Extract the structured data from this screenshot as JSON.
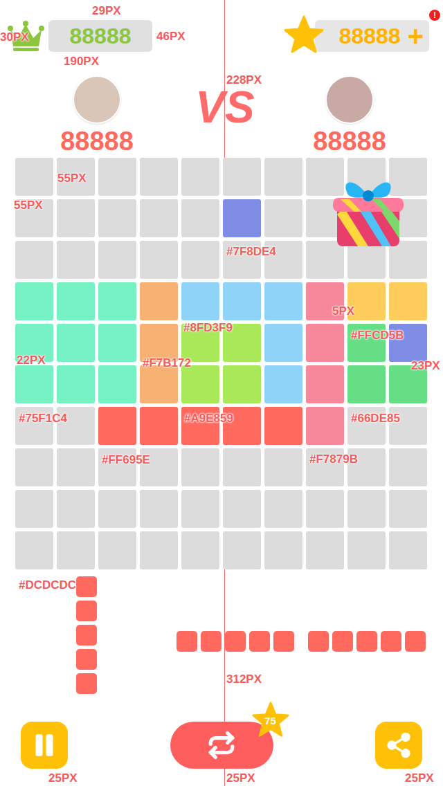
{
  "top_bar": {
    "best_score": "88888",
    "coins": "88888",
    "add_button": "+",
    "alert_badge": "!"
  },
  "vs_label": "VS",
  "players": [
    {
      "score": "88888"
    },
    {
      "score": "88888"
    }
  ],
  "board": {
    "rows": [
      [
        "#DCDCDC",
        "#DCDCDC",
        "#DCDCDC",
        "#DCDCDC",
        "#DCDCDC",
        "#DCDCDC",
        "#DCDCDC",
        "#DCDCDC",
        "#DCDCDC",
        "#DCDCDC"
      ],
      [
        "#DCDCDC",
        "#DCDCDC",
        "#DCDCDC",
        "#DCDCDC",
        "#DCDCDC",
        "#7F8DE4",
        "#DCDCDC",
        "#DCDCDC",
        "#DCDCDC",
        "#DCDCDC"
      ],
      [
        "#DCDCDC",
        "#DCDCDC",
        "#DCDCDC",
        "#DCDCDC",
        "#DCDCDC",
        "#DCDCDC",
        "#DCDCDC",
        "#DCDCDC",
        "#DCDCDC",
        "#DCDCDC"
      ],
      [
        "#75F1C4",
        "#75F1C4",
        "#75F1C4",
        "#F7B172",
        "#8FD3F9",
        "#8FD3F9",
        "#8FD3F9",
        "#F7879B",
        "#FFCD5B",
        "#FFCD5B"
      ],
      [
        "#75F1C4",
        "#75F1C4",
        "#75F1C4",
        "#F7B172",
        "#A9E859",
        "#A9E859",
        "#8FD3F9",
        "#F7879B",
        "#66DE85",
        "#7F8DE4"
      ],
      [
        "#75F1C4",
        "#75F1C4",
        "#75F1C4",
        "#F7B172",
        "#A9E859",
        "#A9E859",
        "#8FD3F9",
        "#F7879B",
        "#66DE85",
        "#66DE85"
      ],
      [
        "#DCDCDC",
        "#DCDCDC",
        "#FF695E",
        "#FF695E",
        "#FF695E",
        "#FF695E",
        "#FF695E",
        "#F7879B",
        "#DCDCDC",
        "#DCDCDC"
      ],
      [
        "#DCDCDC",
        "#DCDCDC",
        "#DCDCDC",
        "#DCDCDC",
        "#DCDCDC",
        "#DCDCDC",
        "#DCDCDC",
        "#DCDCDC",
        "#DCDCDC",
        "#DCDCDC"
      ],
      [
        "#DCDCDC",
        "#DCDCDC",
        "#DCDCDC",
        "#DCDCDC",
        "#DCDCDC",
        "#DCDCDC",
        "#DCDCDC",
        "#DCDCDC",
        "#DCDCDC",
        "#DCDCDC"
      ],
      [
        "#DCDCDC",
        "#DCDCDC",
        "#DCDCDC",
        "#DCDCDC",
        "#DCDCDC",
        "#DCDCDC",
        "#DCDCDC",
        "#DCDCDC",
        "#DCDCDC",
        "#DCDCDC"
      ]
    ]
  },
  "pieces": [
    {
      "kind": "vertical",
      "cells": [
        "#FF695E",
        "#FF695E",
        "#FF695E",
        "#FF695E",
        "#FF695E"
      ]
    },
    {
      "kind": "horizontal",
      "cells": [
        "#FF695E",
        "#FF695E",
        "#FF695E",
        "#FF695E",
        "#FF695E"
      ]
    },
    {
      "kind": "horizontal",
      "cells": [
        "#FF695E",
        "#FF695E",
        "#FF695E",
        "#FF695E",
        "#FF695E"
      ]
    }
  ],
  "buttons": {
    "restart_badge": "75"
  },
  "annotations": [
    "29PX",
    "30PX",
    "46PX",
    "190PX",
    "228PX",
    "55PX",
    "55PX",
    "#7F8DE4",
    "5PX",
    "#8FD3F9",
    "#FFCD5B",
    "22PX",
    "#F7B172",
    "23PX",
    "#75F1C4",
    "#A9E859",
    "#66DE85",
    "#FF695E",
    "#F7879B",
    "#DCDCDC",
    "312PX",
    "25PX",
    "25PX",
    "25PX"
  ]
}
